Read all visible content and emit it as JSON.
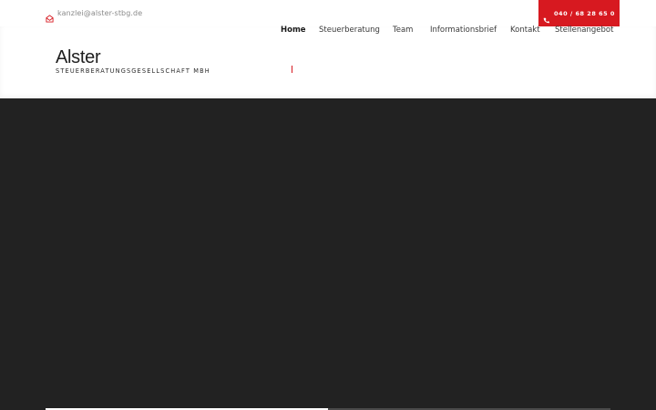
{
  "topbar": {
    "email": "kanzlei@alster-stbg.de",
    "email_icon": "envelope-icon",
    "phone": "040 / 68 28 65 0",
    "phone_icon": "phone-icon",
    "accent_color": "#d71920"
  },
  "brand": {
    "title": "Alster",
    "subtitle": "STEUERBERATUNGSGESELLSCHAFT MBH"
  },
  "nav": {
    "items": [
      {
        "label": "Home",
        "active": true
      },
      {
        "label": "Steuerberatung",
        "active": false
      },
      {
        "label": "Team",
        "active": false
      },
      {
        "label": "Informationsbrief",
        "active": false
      },
      {
        "label": "Kontakt",
        "active": false
      },
      {
        "label": "Stellenangebot",
        "active": false
      }
    ]
  },
  "hero": {
    "background": "#222222"
  }
}
